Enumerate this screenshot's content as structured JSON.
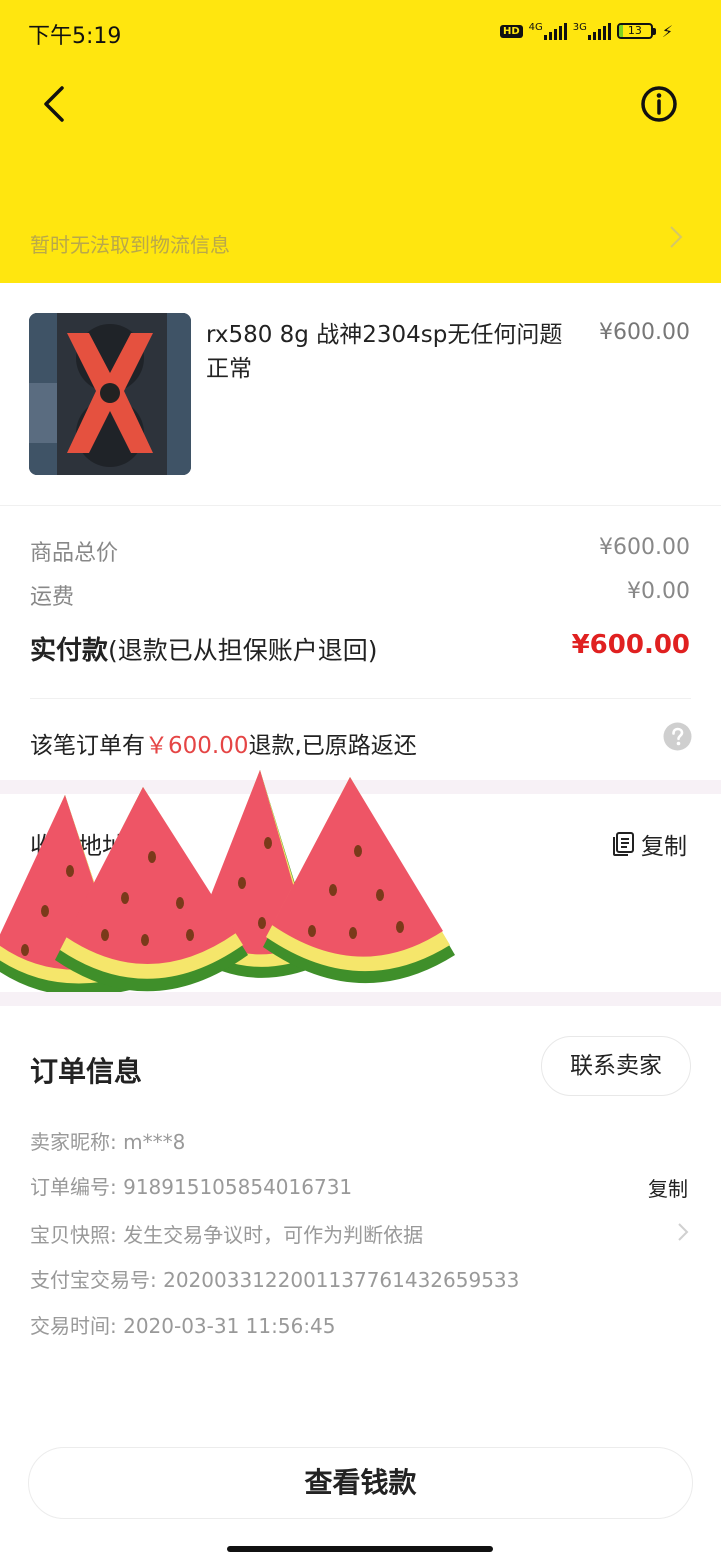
{
  "status_bar": {
    "time": "下午5:19",
    "hd": "HD",
    "net1": "4G",
    "net2": "3G",
    "battery": "13",
    "battery_level": 0.13
  },
  "header": {
    "back_icon": "chevron-left-icon",
    "info_icon": "info-circle-icon",
    "logistics_text": "暂时无法取到物流信息"
  },
  "product": {
    "title": "rx580  8g  战神2304sp无任何问题  正常",
    "price": "¥600.00"
  },
  "summary": {
    "goods_total_label": "商品总价",
    "goods_total_value": "¥600.00",
    "shipping_label": "运费",
    "shipping_value": "¥0.00",
    "paid_label_strong": "实付款",
    "paid_label_note": "(退款已从担保账户退回)",
    "paid_value": "¥600.00"
  },
  "refund": {
    "prefix": "该笔订单有",
    "amount": "￥600.00",
    "suffix": "退款,已原路返还"
  },
  "address": {
    "label_partial": "收货地址",
    "copy_label": "复制"
  },
  "order_info": {
    "title": "订单信息",
    "contact_label": "联系卖家",
    "seller": "卖家昵称: m***8",
    "order_no": "订单编号: 918915105854016731",
    "order_copy": "复制",
    "snapshot": "宝贝快照: 发生交易争议时，可作为判断依据",
    "alipay_no": "支付宝交易号: 2020033122001137761432659533",
    "trade_time": "交易时间: 2020-03-31 11:56:45"
  },
  "bottom": {
    "view_money": "查看钱款"
  },
  "colors": {
    "header_yellow": "#FFE60F",
    "price_red": "#E02020",
    "refund_red": "#E54545"
  }
}
